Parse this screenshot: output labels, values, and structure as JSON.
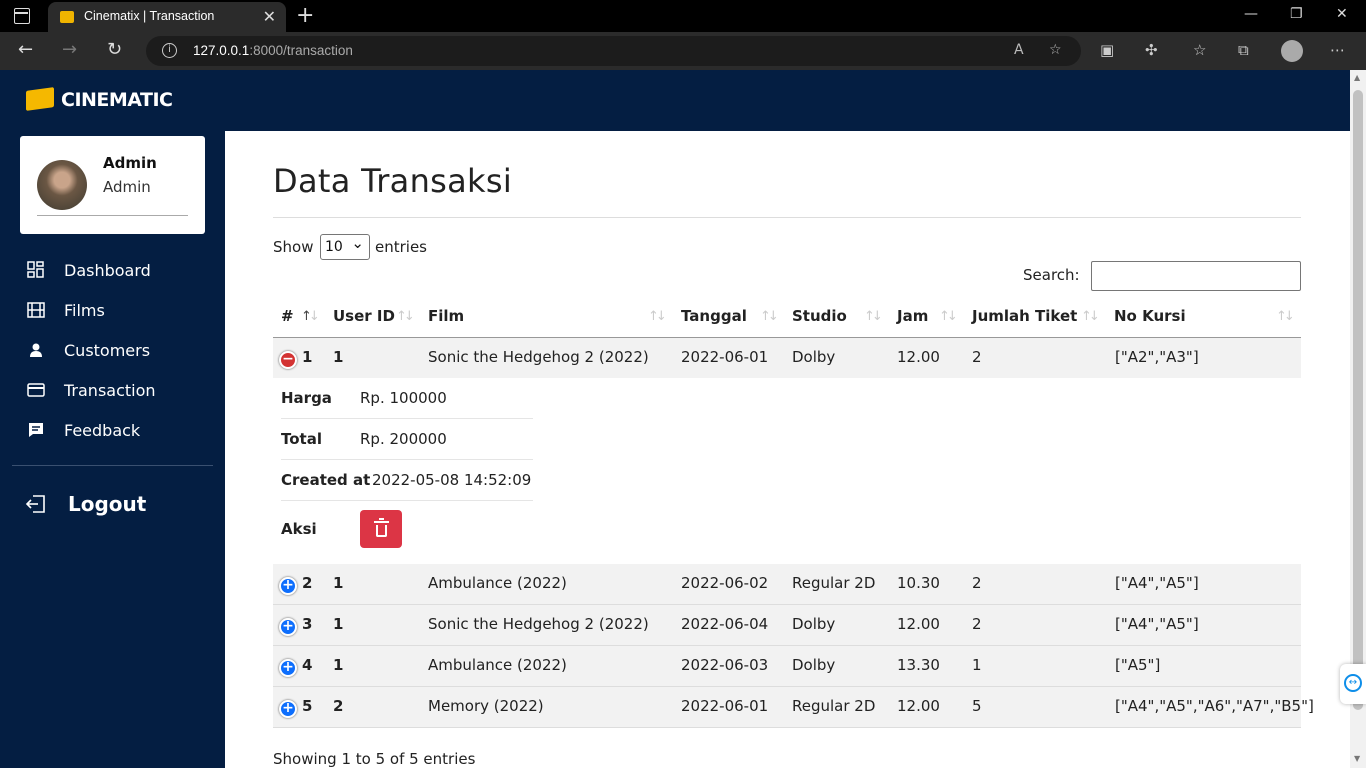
{
  "browser": {
    "tab_title": "Cinematix | Transaction",
    "url_host": "127.0.0.1",
    "url_rest": ":8000/transaction"
  },
  "app": {
    "logo": "CINEMATIC",
    "brand_color": "#041e42"
  },
  "profile": {
    "name": "Admin",
    "role": "Admin"
  },
  "sidebar": {
    "items": [
      {
        "label": "Dashboard",
        "icon": "grid-icon"
      },
      {
        "label": "Films",
        "icon": "film-icon"
      },
      {
        "label": "Customers",
        "icon": "user-icon"
      },
      {
        "label": "Transaction",
        "icon": "card-icon"
      },
      {
        "label": "Feedback",
        "icon": "message-icon"
      }
    ],
    "logout": "Logout"
  },
  "page": {
    "title": "Data Transaksi",
    "show": "Show",
    "entries": "entries",
    "length_value": "10",
    "search_label": "Search:",
    "search_value": "",
    "info": "Showing 1 to 5 of 5 entries"
  },
  "table": {
    "headers": [
      "#",
      "User ID",
      "Film",
      "Tanggal",
      "Studio",
      "Jam",
      "Jumlah Tiket",
      "No Kursi"
    ],
    "rows": [
      {
        "no": "1",
        "user_id": "1",
        "film": "Sonic the Hedgehog 2 (2022)",
        "tanggal": "2022-06-01",
        "studio": "Dolby",
        "jam": "12.00",
        "jumlah": "2",
        "kursi": "[\"A2\",\"A3\"]",
        "expanded": true
      },
      {
        "no": "2",
        "user_id": "1",
        "film": "Ambulance (2022)",
        "tanggal": "2022-06-02",
        "studio": "Regular 2D",
        "jam": "10.30",
        "jumlah": "2",
        "kursi": "[\"A4\",\"A5\"]",
        "expanded": false
      },
      {
        "no": "3",
        "user_id": "1",
        "film": "Sonic the Hedgehog 2 (2022)",
        "tanggal": "2022-06-04",
        "studio": "Dolby",
        "jam": "12.00",
        "jumlah": "2",
        "kursi": "[\"A4\",\"A5\"]",
        "expanded": false
      },
      {
        "no": "4",
        "user_id": "1",
        "film": "Ambulance (2022)",
        "tanggal": "2022-06-03",
        "studio": "Dolby",
        "jam": "13.30",
        "jumlah": "1",
        "kursi": "[\"A5\"]",
        "expanded": false
      },
      {
        "no": "5",
        "user_id": "2",
        "film": "Memory (2022)",
        "tanggal": "2022-06-01",
        "studio": "Regular 2D",
        "jam": "12.00",
        "jumlah": "5",
        "kursi": "[\"A4\",\"A5\",\"A6\",\"A7\",\"B5\"]",
        "expanded": false
      }
    ],
    "detail": {
      "harga_label": "Harga",
      "harga": "Rp. 100000",
      "total_label": "Total",
      "total": "Rp. 200000",
      "created_label": "Created at",
      "created": "2022-05-08 14:52:09",
      "aksi_label": "Aksi"
    }
  }
}
